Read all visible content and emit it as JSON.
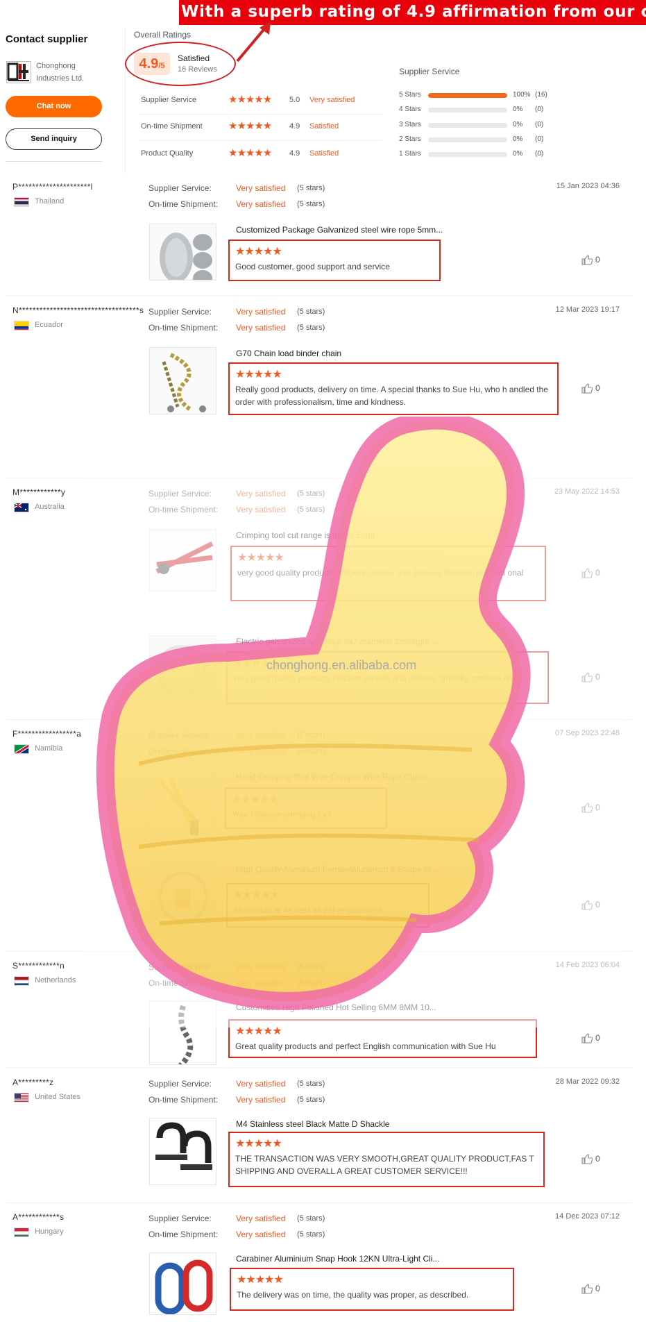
{
  "banner": "With a superb rating of 4.9 affirmation from our customers",
  "contact": {
    "title": "Contact supplier",
    "company_line1": "Chonghong",
    "company_line2": "Industries Ltd.",
    "chat": "Chat now",
    "inquiry": "Send inquiry"
  },
  "overall": {
    "label": "Overall Ratings",
    "score": "4.9",
    "score_suffix": "/5",
    "word": "Satisfied",
    "count": "16 Reviews"
  },
  "summary": [
    {
      "label": "Supplier Service",
      "stars": "★★★★★",
      "value": "5.0",
      "word": "Very satisfied"
    },
    {
      "label": "On-time Shipment",
      "stars": "★★★★★",
      "value": "4.9",
      "word": "Satisfied"
    },
    {
      "label": "Product Quality",
      "stars": "★★★★★",
      "value": "4.9",
      "word": "Satisfied"
    }
  ],
  "service": {
    "title": "Supplier Service",
    "rows": [
      {
        "label": "5 Stars",
        "pct": "100%",
        "count": "(16)",
        "fill": 1.0
      },
      {
        "label": "4 Stars",
        "pct": "0%",
        "count": "(0)",
        "fill": 0
      },
      {
        "label": "3 Stars",
        "pct": "0%",
        "count": "(0)",
        "fill": 0
      },
      {
        "label": "2 Stars",
        "pct": "0%",
        "count": "(0)",
        "fill": 0
      },
      {
        "label": "1 Stars",
        "pct": "0%",
        "count": "(0)",
        "fill": 0
      }
    ]
  },
  "labels": {
    "supplier_service": "Supplier Service:",
    "ontime": "On-time Shipment:",
    "very_satisfied": "Very satisfied",
    "five_stars": "(5 stars)",
    "stars_icon": "★★★★★",
    "likes": "0"
  },
  "reviews": [
    {
      "name": "P*********************l",
      "country": "Thailand",
      "date": "15 Jan 2023 04:36",
      "products": [
        {
          "title": "Customized Package Galvanized steel wire rope 5mm...",
          "text": "Good customer, good support and service"
        }
      ]
    },
    {
      "name": "N***********************************s",
      "country": "Ecuador",
      "date": "12 Mar 2023 19:17",
      "products": [
        {
          "title": "G70 Chain load binder chain",
          "text": "Really good products, delivery on time. A special thanks to Sue Hu, who h andled the order with professionalism, time and kindness."
        }
      ]
    },
    {
      "name": "M************y",
      "country": "Australia",
      "date": "23 May 2022 14:53",
      "products": [
        {
          "title": "Crimping tool cut range is under 5mm",
          "text": "very good quality products efficient service and delivery. friendly, professi onal"
        },
        {
          "title": "Electric galvanized wire rope 6x7 diameter 2mmright ...",
          "text": "very good quality products efficient service and delivery. friendly, professi onal"
        }
      ]
    },
    {
      "name": "F*****************a",
      "country": "Namibia",
      "date": "07 Sep 2023 22:48",
      "products": [
        {
          "title": "Hand Crimping Tool Wire Crimper Wire Rope Cutter",
          "text": "Your Ultimate  crimping  tool"
        },
        {
          "title": "High Quality Aluminum Ferrule/Aluminum 8 Shape Sl...",
          "text": "Aluminium  at its best  as per requirement"
        }
      ]
    },
    {
      "name": "S************n",
      "country": "Netherlands",
      "date": "14 Feb 2023 06:04",
      "products": [
        {
          "title": "Customized High Polished Hot Selling 6MM 8MM 10...",
          "text": "Great quality products and perfect English communication with Sue Hu"
        }
      ]
    },
    {
      "name": "A*********z",
      "country": "United States",
      "date": "28 Mar 2022 09:32",
      "products": [
        {
          "title": "M4 Stainless steel Black Matte D Shackle",
          "text": "THE TRANSACTION WAS VERY SMOOTH,GREAT QUALITY PRODUCT,FAS T SHIPPING AND OVERALL A GREAT CUSTOMER SERVICE!!!"
        }
      ]
    },
    {
      "name": "A************s",
      "country": "Hungary",
      "date": "14 Dec 2023 07:12",
      "products": [
        {
          "title": "Carabiner Aluminium Snap Hook 12KN Ultra-Light Cli...",
          "text": "The delivery was on time, the quality was proper, as described."
        }
      ]
    }
  ],
  "watermark": "chonghong.en.alibaba.com",
  "colors": {
    "accent": "#f05a22",
    "highlight": "#d42a1e",
    "banner": "#e8000b"
  }
}
